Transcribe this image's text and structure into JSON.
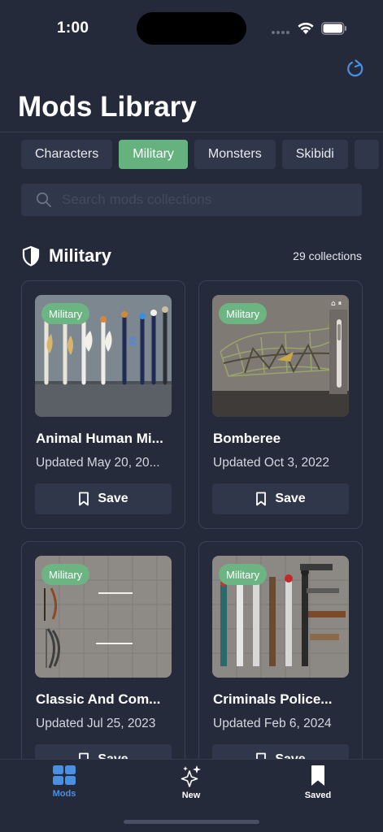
{
  "status_bar": {
    "time": "1:00"
  },
  "header": {
    "title": "Mods Library"
  },
  "categories": [
    {
      "label": "Characters",
      "active": false
    },
    {
      "label": "Military",
      "active": true
    },
    {
      "label": "Monsters",
      "active": false
    },
    {
      "label": "Skibidi",
      "active": false
    }
  ],
  "search": {
    "placeholder": "Search mods collections",
    "value": ""
  },
  "section": {
    "title": "Military",
    "count": "29 collections"
  },
  "cards": [
    {
      "badge": "Military",
      "title": "Animal Human Mi...",
      "updated": "Updated May 20, 20...",
      "save_label": "Save"
    },
    {
      "badge": "Military",
      "title": "Bomberee",
      "updated": "Updated Oct 3, 2022",
      "save_label": "Save"
    },
    {
      "badge": "Military",
      "title": "Classic And Com...",
      "updated": "Updated Jul 25, 2023",
      "save_label": "Save"
    },
    {
      "badge": "Military",
      "title": "Criminals Police...",
      "updated": "Updated Feb 6, 2024",
      "save_label": "Save"
    }
  ],
  "tab_bar": {
    "tabs": [
      {
        "label": "Mods",
        "icon": "grid-icon",
        "active": true
      },
      {
        "label": "New",
        "icon": "sparkles-icon",
        "active": false
      },
      {
        "label": "Saved",
        "icon": "bookmark-icon",
        "active": false
      }
    ]
  },
  "colors": {
    "background": "#252a3b",
    "surface": "#31374a",
    "accent_green": "#65b27e",
    "accent_blue": "#4a90e2"
  }
}
